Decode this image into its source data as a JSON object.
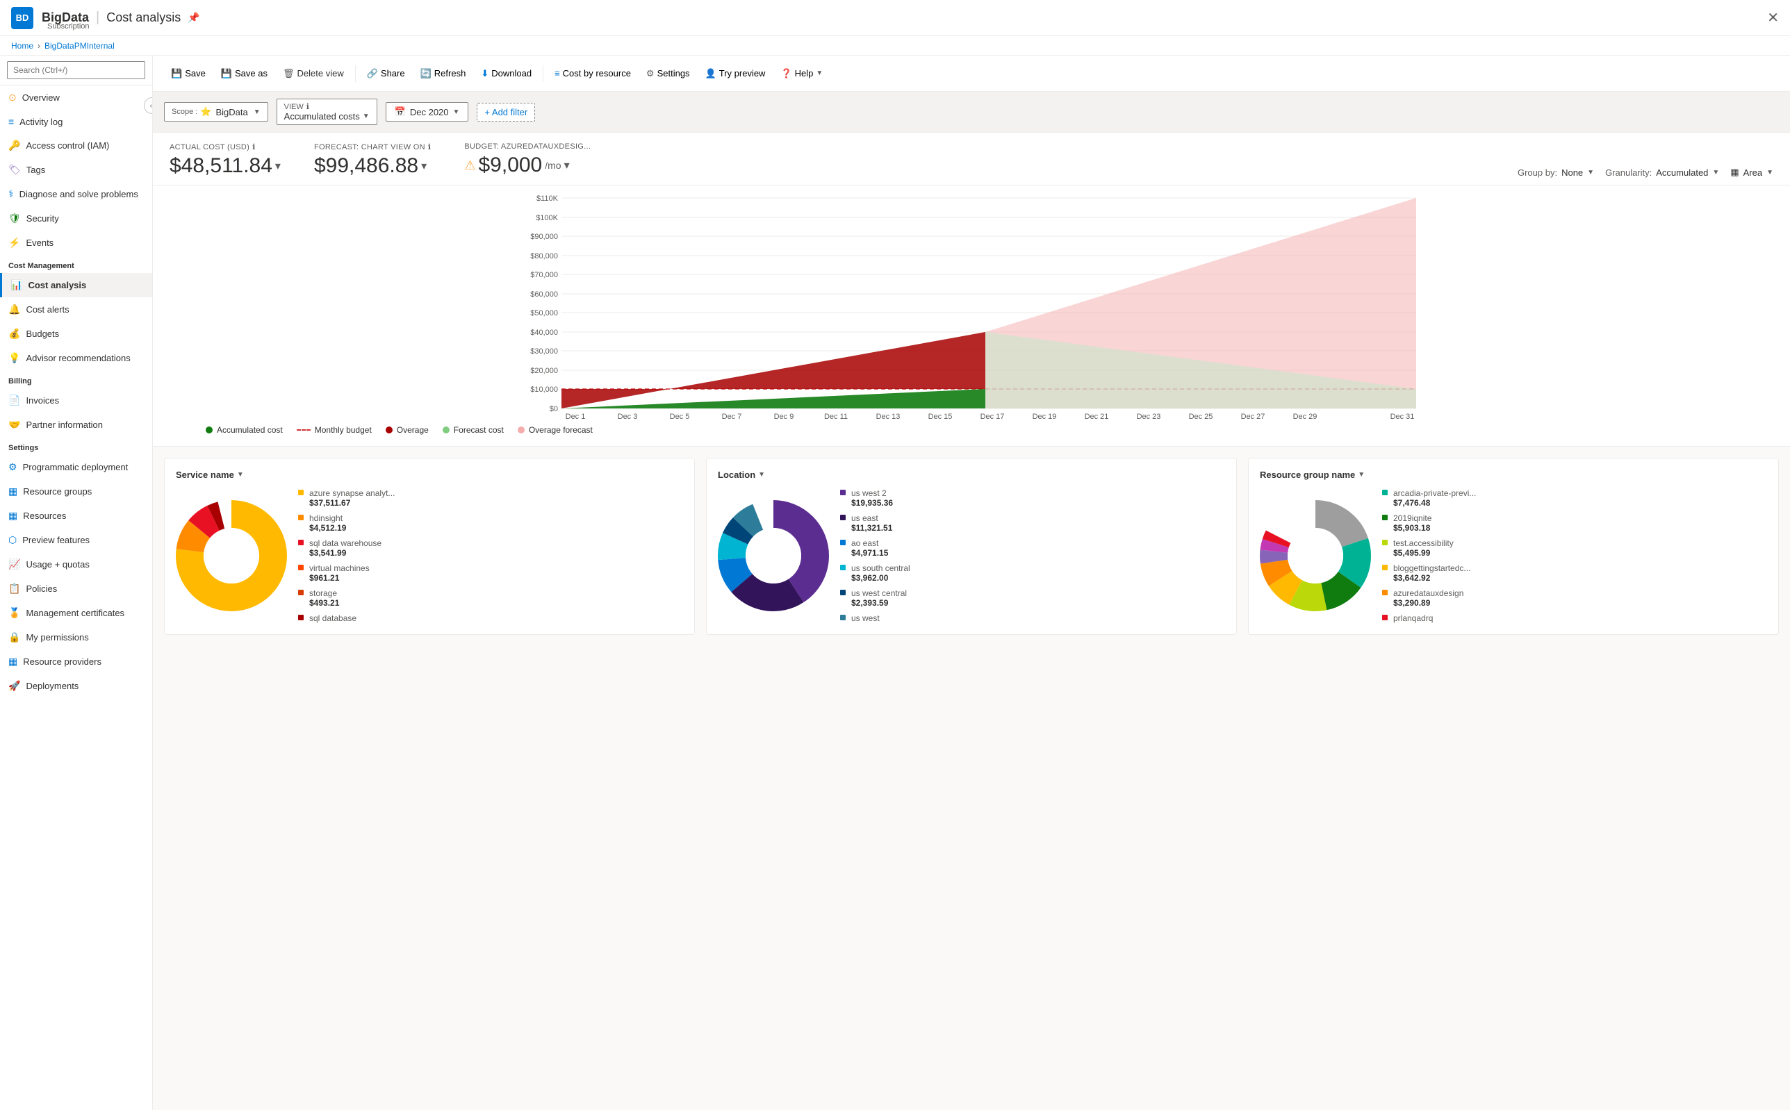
{
  "breadcrumb": {
    "home": "Home",
    "subscription": "BigDataPMInternal"
  },
  "header": {
    "logo": "BD",
    "title": "BigData",
    "separator": "|",
    "page": "Cost analysis",
    "subtitle": "Subscription",
    "pin_icon": "📌",
    "close_icon": "✕"
  },
  "toolbar": {
    "save": "Save",
    "save_as": "Save as",
    "delete_view": "Delete view",
    "share": "Share",
    "refresh": "Refresh",
    "download": "Download",
    "cost_by_resource": "Cost by resource",
    "settings": "Settings",
    "try_preview": "Try preview",
    "help": "Help"
  },
  "filter_bar": {
    "scope_label": "Scope :",
    "scope_value": "BigData",
    "view_label": "VIEW",
    "view_info": "ℹ",
    "view_value": "Accumulated costs",
    "date_icon": "📅",
    "date_value": "Dec 2020",
    "add_filter": "+ Add filter"
  },
  "cost_cards": {
    "actual_cost_label": "ACTUAL COST (USD)",
    "actual_cost_info": "ℹ",
    "actual_cost_value": "$48,511.84",
    "forecast_label": "FORECAST: CHART VIEW ON",
    "forecast_info": "ℹ",
    "forecast_value": "$99,486.88",
    "budget_label": "BUDGET: AZUREDATAUXDESIG...",
    "budget_warning": "⚠",
    "budget_value": "$9,000",
    "budget_period": "/mo"
  },
  "chart_controls": {
    "group_by_label": "Group by:",
    "group_by_value": "None",
    "granularity_label": "Granularity:",
    "granularity_value": "Accumulated",
    "area_label": "Area"
  },
  "chart": {
    "y_labels": [
      "$110K",
      "$100K",
      "$90,000",
      "$80,000",
      "$70,000",
      "$60,000",
      "$50,000",
      "$40,000",
      "$30,000",
      "$20,000",
      "$10,000",
      "$0"
    ],
    "x_labels": [
      "Dec 1",
      "Dec 3",
      "Dec 5",
      "Dec 7",
      "Dec 9",
      "Dec 11",
      "Dec 13",
      "Dec 15",
      "Dec 17",
      "Dec 19",
      "Dec 21",
      "Dec 23",
      "Dec 25",
      "Dec 27",
      "Dec 29",
      "Dec 31"
    ],
    "legend": [
      {
        "label": "Accumulated cost",
        "color": "#107c10",
        "type": "dot"
      },
      {
        "label": "Monthly budget",
        "color": "#d13438",
        "type": "dashed"
      },
      {
        "label": "Overage",
        "color": "#a80000",
        "type": "dot"
      },
      {
        "label": "Forecast cost",
        "color": "#80cc80",
        "type": "dot"
      },
      {
        "label": "Overage forecast",
        "color": "#f4acac",
        "type": "dot"
      }
    ]
  },
  "sidebar": {
    "search_placeholder": "Search (Ctrl+/)",
    "items": [
      {
        "label": "Overview",
        "icon": "⊙",
        "color": "#ffaa44",
        "section": null
      },
      {
        "label": "Activity log",
        "icon": "≡",
        "color": "#0078d4",
        "section": null
      },
      {
        "label": "Access control (IAM)",
        "icon": "🔑",
        "color": "#0078d4",
        "section": null
      },
      {
        "label": "Tags",
        "icon": "🏷",
        "color": "#8764b8",
        "section": null
      },
      {
        "label": "Diagnose and solve problems",
        "icon": "⚕",
        "color": "#0078d4",
        "section": null
      },
      {
        "label": "Security",
        "icon": "🛡",
        "color": "#107c10",
        "section": null
      },
      {
        "label": "Events",
        "icon": "⚡",
        "color": "#ffaa44",
        "section": null
      }
    ],
    "cost_management": {
      "title": "Cost Management",
      "items": [
        {
          "label": "Cost analysis",
          "icon": "📊",
          "color": "#107c10",
          "active": true
        },
        {
          "label": "Cost alerts",
          "icon": "🔔",
          "color": "#107c10"
        },
        {
          "label": "Budgets",
          "icon": "💰",
          "color": "#107c10"
        },
        {
          "label": "Advisor recommendations",
          "icon": "💡",
          "color": "#107c10"
        }
      ]
    },
    "billing": {
      "title": "Billing",
      "items": [
        {
          "label": "Invoices",
          "icon": "📄",
          "color": "#0078d4"
        },
        {
          "label": "Partner information",
          "icon": "🤝",
          "color": "#0078d4"
        }
      ]
    },
    "settings": {
      "title": "Settings",
      "items": [
        {
          "label": "Programmatic deployment",
          "icon": "⚙",
          "color": "#0078d4"
        },
        {
          "label": "Resource groups",
          "icon": "▦",
          "color": "#0078d4"
        },
        {
          "label": "Resources",
          "icon": "▦",
          "color": "#0078d4"
        },
        {
          "label": "Preview features",
          "icon": "⬡",
          "color": "#0078d4"
        },
        {
          "label": "Usage + quotas",
          "icon": "📈",
          "color": "#0078d4"
        },
        {
          "label": "Policies",
          "icon": "📋",
          "color": "#0078d4"
        },
        {
          "label": "Management certificates",
          "icon": "🏅",
          "color": "#0078d4"
        },
        {
          "label": "My permissions",
          "icon": "🔒",
          "color": "#0078d4"
        },
        {
          "label": "Resource providers",
          "icon": "▦",
          "color": "#0078d4"
        },
        {
          "label": "Deployments",
          "icon": "🚀",
          "color": "#0078d4"
        }
      ]
    }
  },
  "donut_charts": [
    {
      "title": "Service name",
      "items": [
        {
          "label": "azure synapse analyt...",
          "value": "$37,511.67",
          "color": "#ffb900"
        },
        {
          "label": "hdinsight",
          "value": "$4,512.19",
          "color": "#ff8c00"
        },
        {
          "label": "sql data warehouse",
          "value": "$3,541.99",
          "color": "#e81123"
        },
        {
          "label": "virtual machines",
          "value": "$961.21",
          "color": "#ff4500"
        },
        {
          "label": "storage",
          "value": "$493.21",
          "color": "#d83b01"
        },
        {
          "label": "sql database",
          "value": "",
          "color": "#a80000"
        }
      ],
      "colors": [
        "#ffb900",
        "#ff8c00",
        "#e81123",
        "#ff4500",
        "#d83b01",
        "#a80000",
        "#ff6b35",
        "#ffd700"
      ]
    },
    {
      "title": "Location",
      "items": [
        {
          "label": "us west 2",
          "value": "$19,935.36",
          "color": "#5c2d91"
        },
        {
          "label": "us east",
          "value": "$11,321.51",
          "color": "#32145a"
        },
        {
          "label": "ao east",
          "value": "$4,971.15",
          "color": "#0078d4"
        },
        {
          "label": "us south central",
          "value": "$3,962.00",
          "color": "#00b4d2"
        },
        {
          "label": "us west central",
          "value": "$2,393.59",
          "color": "#2d7d9a"
        },
        {
          "label": "us west",
          "value": "",
          "color": "#004578"
        }
      ],
      "colors": [
        "#5c2d91",
        "#32145a",
        "#0078d4",
        "#00b4d2",
        "#2d7d9a",
        "#004578",
        "#00bcf2",
        "#50e6ff"
      ]
    },
    {
      "title": "Resource group name",
      "items": [
        {
          "label": "arcadia-private-previ...",
          "value": "$7,476.48",
          "color": "#00b294"
        },
        {
          "label": "2019iqnite",
          "value": "$5,903.18",
          "color": "#107c10"
        },
        {
          "label": "test.accessibility",
          "value": "$5,495.99",
          "color": "#bad80a"
        },
        {
          "label": "bloggettingstartedc...",
          "value": "$3,642.92",
          "color": "#ffb900"
        },
        {
          "label": "azuredatauxdesign",
          "value": "$3,290.89",
          "color": "#ff8c00"
        },
        {
          "label": "prlanqadrq",
          "value": "",
          "color": "#e81123"
        }
      ],
      "colors": [
        "#00b294",
        "#107c10",
        "#bad80a",
        "#ffb900",
        "#ff8c00",
        "#e81123",
        "#8764b8",
        "#c239b3",
        "#9a0089",
        "#0099bc"
      ]
    }
  ]
}
